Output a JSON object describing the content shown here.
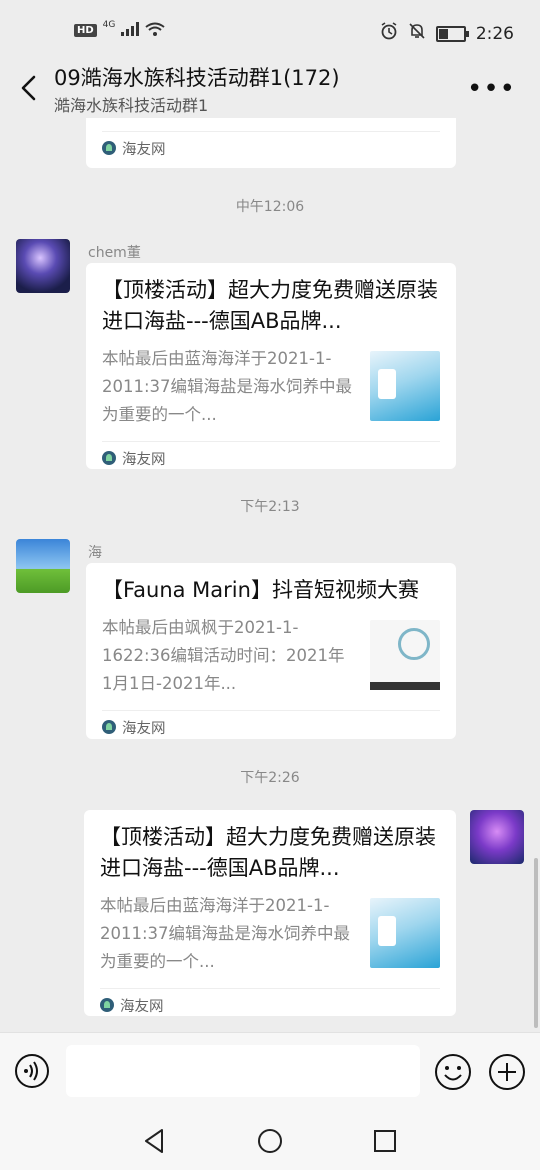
{
  "status_bar": {
    "hd": "HD",
    "network": "4G",
    "time": "2:26"
  },
  "header": {
    "title": "09澔海水族科技活动群1(172)",
    "subtitle": "澔海水族科技活动群1",
    "more_label": "•••"
  },
  "messages": {
    "top_partial": {
      "source": "海友网"
    },
    "ts1": "中午12:06",
    "msg1": {
      "sender": "chem董",
      "title": "【顶楼活动】超大力度免费赠送原装进口海盐---德国AB品牌...",
      "desc": "本帖最后由蓝海海洋于2021-1-2011:37编辑海盐是海水饲养中最为重要的一个...",
      "source": "海友网"
    },
    "ts2": "下午2:13",
    "msg2": {
      "sender": "海",
      "title": "【Fauna Marin】抖音短视频大赛",
      "desc": "本帖最后由飒枫于2021-1-1622:36编辑活动时间：2021年1月1日-2021年...",
      "source": "海友网"
    },
    "ts3": "下午2:26",
    "msg3": {
      "title": "【顶楼活动】超大力度免费赠送原装进口海盐---德国AB品牌...",
      "desc": "本帖最后由蓝海海洋于2021-1-2011:37编辑海盐是海水饲养中最为重要的一个...",
      "source": "海友网"
    }
  },
  "input_bar": {
    "value": ""
  },
  "icons": {
    "back": "back-arrow-icon",
    "voice": "voice-icon",
    "emoji": "emoji-icon",
    "plus": "plus-icon"
  }
}
